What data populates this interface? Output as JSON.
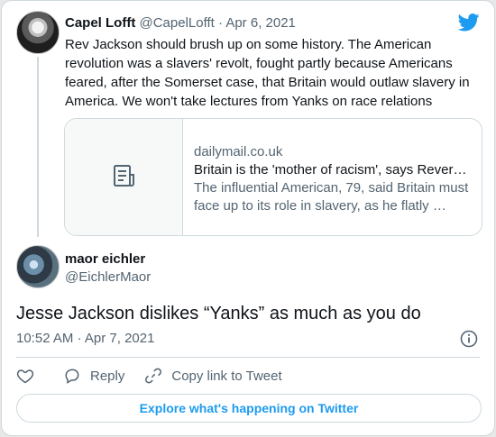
{
  "quoted_tweet": {
    "author_name": "Capel Lofft",
    "handle_and_date": "@CapelLofft · Apr 6, 2021",
    "text": "Rev Jackson should brush up on some history. The American revolution was a slavers' revolt, fought partly because Americans feared, after the Somerset case, that Britain would outlaw slavery in America. We won't take lectures from Yanks on race relations",
    "link_card": {
      "domain": "dailymail.co.uk",
      "title": "Britain is the 'mother of racism', says Rever…",
      "description": "The influential American, 79, said Britain must face up to its role in slavery, as he flatly …"
    }
  },
  "main_tweet": {
    "author_name": "maor eichler",
    "handle": "@EichlerMaor",
    "text": "Jesse Jackson dislikes “Yanks” as much as you do",
    "timestamp": "10:52 AM · Apr 7, 2021"
  },
  "actions": {
    "reply_label": "Reply",
    "copy_link_label": "Copy link to Tweet"
  },
  "explore_label": "Explore what's happening on Twitter",
  "colors": {
    "accent": "#1d9bf0",
    "text_primary": "#0f1419",
    "text_secondary": "#536471",
    "border": "#cfd9de"
  }
}
